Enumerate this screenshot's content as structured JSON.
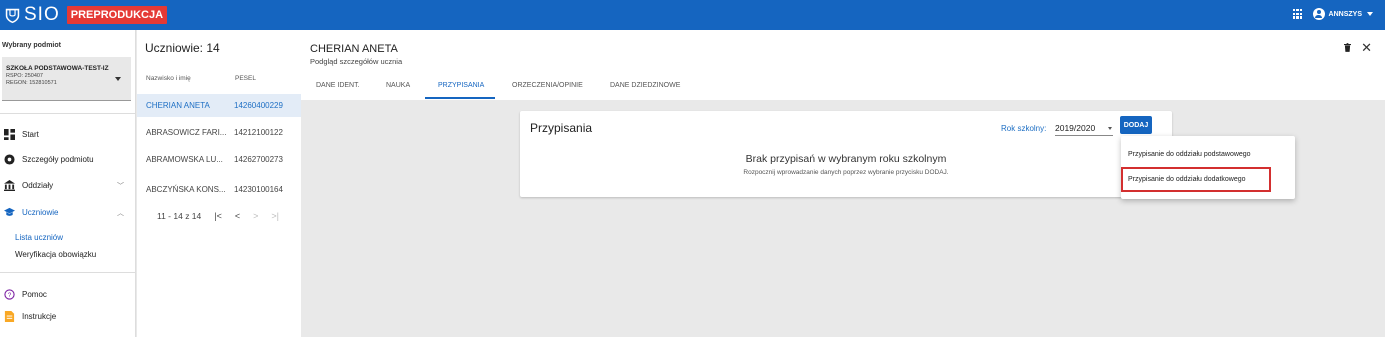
{
  "topbar": {
    "logo_text": "SIO",
    "env_badge": "PREPRODUKCJA",
    "username": "ANNSZYS",
    "bg_color": "#1565c0",
    "badge_color": "#e53935"
  },
  "sidebar": {
    "heading": "Wybrany podmiot",
    "entity": {
      "name": "SZKOŁA PODSTAWOWA-TEST-IZ",
      "rspo": "RSPO: 250407",
      "regon": "REGON: 152810571"
    },
    "nav": [
      {
        "label": "Start",
        "icon": "dashboard-icon"
      },
      {
        "label": "Szczegóły podmiotu",
        "icon": "info-icon"
      },
      {
        "label": "Oddziały",
        "icon": "building-icon",
        "chevron": "﹀"
      },
      {
        "label": "Uczniowie",
        "icon": "graduation-cap-icon",
        "chevron": "︿"
      }
    ],
    "subitems": [
      "Lista uczniów",
      "Weryfikacja obowiązku"
    ],
    "bottom": [
      {
        "label": "Pomoc",
        "icon": "help-icon"
      },
      {
        "label": "Instrukcje",
        "icon": "document-icon"
      }
    ]
  },
  "students": {
    "title": "Uczniowie: 14",
    "col_name": "Nazwisko i imię",
    "col_pesel": "PESEL",
    "rows": [
      {
        "name": "CHERIAN ANETA",
        "pesel": "14260400229"
      },
      {
        "name": "ABRASOWICZ FARI...",
        "pesel": "14212100122"
      },
      {
        "name": "ABRAMOWSKA LU...",
        "pesel": "14262700273"
      },
      {
        "name": "ABCZYŃSKA KONS...",
        "pesel": "14230100164"
      }
    ],
    "pager": {
      "range": "11 - 14 z 14",
      "first": "|<",
      "prev": "<",
      "next": ">",
      "last": ">|"
    }
  },
  "main": {
    "title": "CHERIAN ANETA",
    "subtitle": "Podgląd szczegółów ucznia",
    "tabs": [
      "DANE IDENT.",
      "NAUKA",
      "PRZYPISANIA",
      "ORZECZENIA/OPINIE",
      "DANE DZIEDZINOWE"
    ],
    "active_tab": "PRZYPISANIA"
  },
  "card": {
    "title": "Przypisania",
    "year_label": "Rok szkolny:",
    "year_value": "2019/2020",
    "add_label": "DODAJ",
    "empty_title": "Brak przypisań w wybranym roku szkolnym",
    "empty_text": "Rozpocznij wprowadzanie danych poprzez wybranie przycisku DODAJ."
  },
  "dropdown": {
    "items": [
      "Przypisanie do oddziału podstawowego",
      "Przypisanie do oddziału dodatkowego"
    ]
  }
}
